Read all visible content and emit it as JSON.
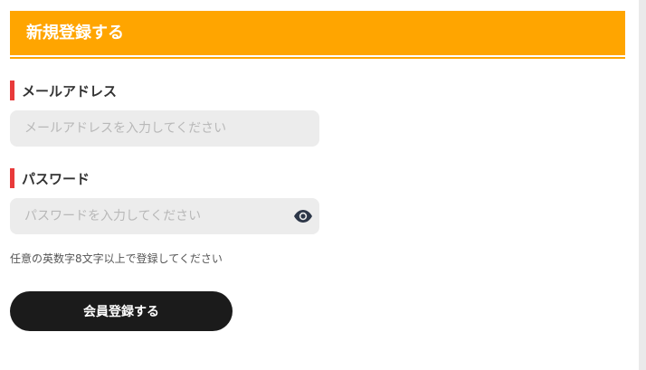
{
  "header": {
    "title": "新規登録する"
  },
  "email": {
    "label": "メールアドレス",
    "placeholder": "メールアドレスを入力してください",
    "value": ""
  },
  "password": {
    "label": "パスワード",
    "placeholder": "パスワードを入力してください",
    "value": "",
    "toggle_icon": "eye-icon"
  },
  "hint": "任意の英数字8文字以上で登録してください",
  "submit_label": "会員登録する",
  "colors": {
    "accent": "#ffa500",
    "label_marker": "#e83a3a",
    "button": "#1b1b1b",
    "input_bg": "#ececec"
  }
}
